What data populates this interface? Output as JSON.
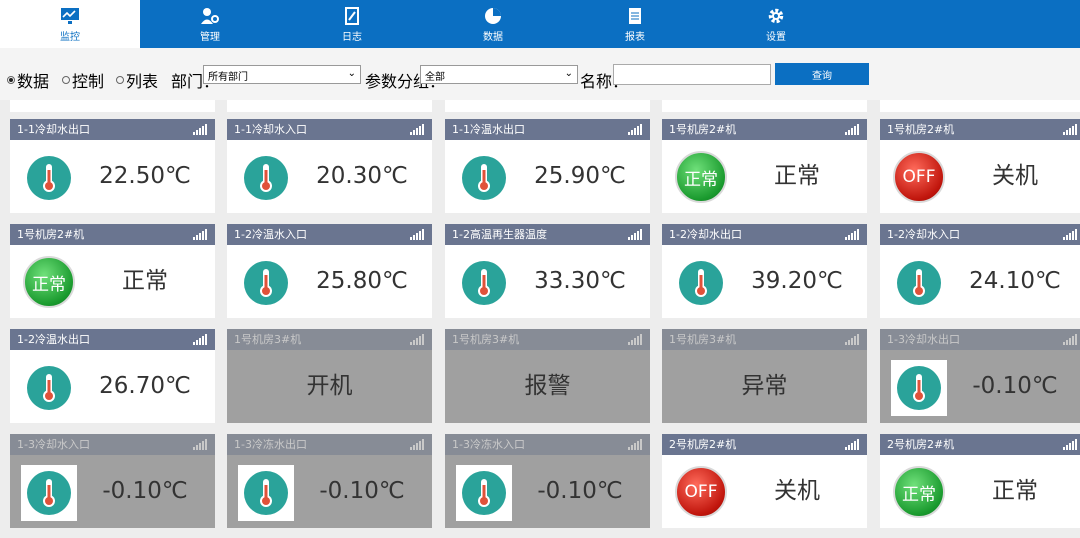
{
  "nav": [
    {
      "label": "监控",
      "icon": "chart-monitor-icon",
      "active": true
    },
    {
      "label": "管理",
      "icon": "user-gear-icon",
      "active": false
    },
    {
      "label": "日志",
      "icon": "notebook-icon",
      "active": false
    },
    {
      "label": "数据",
      "icon": "pie-chart-icon",
      "active": false
    },
    {
      "label": "报表",
      "icon": "document-icon",
      "active": false
    },
    {
      "label": "设置",
      "icon": "gear-icon",
      "active": false
    }
  ],
  "toolbar": {
    "radios": [
      {
        "label": "数据",
        "checked": true
      },
      {
        "label": "控制",
        "checked": false
      },
      {
        "label": "列表",
        "checked": false
      }
    ],
    "dept_label": "部门：",
    "dept_value": "所有部门",
    "group_label": "参数分组：",
    "group_value": "全部",
    "name_label": "名称：",
    "name_value": "",
    "query_label": "查询"
  },
  "colors": {
    "brand": "#0b6fc2",
    "card_header": "#6a7590",
    "offline": "#a0a0a0",
    "normal_green": "#1a9a2e",
    "off_red": "#c0150c"
  },
  "cards": [
    {
      "title": "1-1冷却水出口",
      "kind": "temp",
      "value": "22.50℃",
      "dim": false
    },
    {
      "title": "1-1冷却水入口",
      "kind": "temp",
      "value": "20.30℃",
      "dim": false
    },
    {
      "title": "1-1冷温水出口",
      "kind": "temp",
      "value": "25.90℃",
      "dim": false
    },
    {
      "title": "1号机房2#机",
      "kind": "badge",
      "badge": "正常",
      "badge_color": "green",
      "value": "正常",
      "dim": false
    },
    {
      "title": "1号机房2#机",
      "kind": "badge",
      "badge": "OFF",
      "badge_color": "red",
      "value": "关机",
      "dim": false
    },
    {
      "title": "1号机房2#机",
      "kind": "badge",
      "badge": "正常",
      "badge_color": "green",
      "value": "正常",
      "dim": false
    },
    {
      "title": "1-2冷温水入口",
      "kind": "temp",
      "value": "25.80℃",
      "dim": false
    },
    {
      "title": "1-2高温再生器温度",
      "kind": "temp",
      "value": "33.30℃",
      "dim": false
    },
    {
      "title": "1-2冷却水出口",
      "kind": "temp",
      "value": "39.20℃",
      "dim": false
    },
    {
      "title": "1-2冷却水入口",
      "kind": "temp",
      "value": "24.10℃",
      "dim": false
    },
    {
      "title": "1-2冷温水出口",
      "kind": "temp",
      "value": "26.70℃",
      "dim": false
    },
    {
      "title": "1号机房3#机",
      "kind": "text",
      "value": "开机",
      "dim": true
    },
    {
      "title": "1号机房3#机",
      "kind": "text",
      "value": "报警",
      "dim": true
    },
    {
      "title": "1号机房3#机",
      "kind": "text",
      "value": "异常",
      "dim": true
    },
    {
      "title": "1-3冷却水出口",
      "kind": "temp",
      "value": "-0.10℃",
      "dim": true
    },
    {
      "title": "1-3冷却水入口",
      "kind": "temp",
      "value": "-0.10℃",
      "dim": true
    },
    {
      "title": "1-3冷冻水出口",
      "kind": "temp",
      "value": "-0.10℃",
      "dim": true
    },
    {
      "title": "1-3冷冻水入口",
      "kind": "temp",
      "value": "-0.10℃",
      "dim": true
    },
    {
      "title": "2号机房2#机",
      "kind": "badge",
      "badge": "OFF",
      "badge_color": "red",
      "value": "关机",
      "dim": false
    },
    {
      "title": "2号机房2#机",
      "kind": "badge",
      "badge": "正常",
      "badge_color": "green",
      "value": "正常",
      "dim": false
    }
  ]
}
